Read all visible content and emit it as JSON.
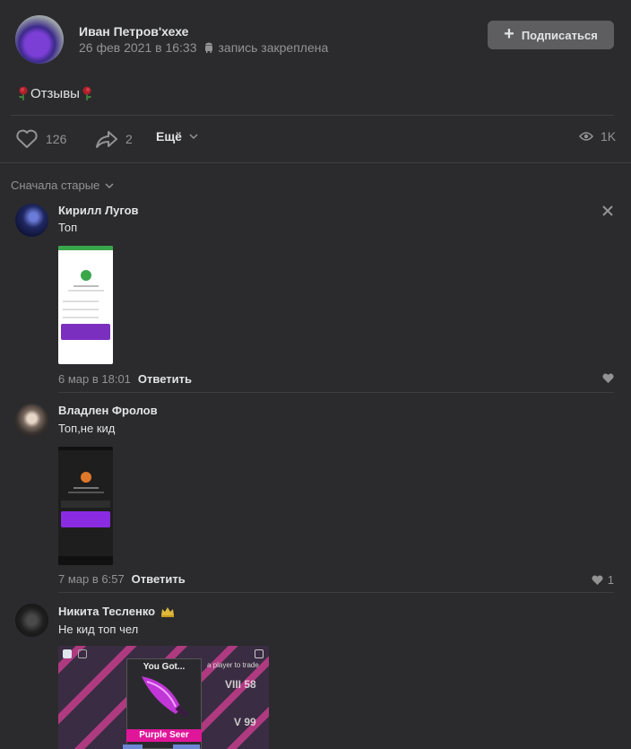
{
  "post": {
    "author": "Иван Петров'хехе",
    "date": "26 фев 2021 в 16:33",
    "pinned": "запись закреплена",
    "subscribe_label": "Подписаться",
    "text": "Отзывы",
    "likes": "126",
    "shares": "2",
    "more_label": "Ещё",
    "views": "1K"
  },
  "comments_sort": "Сначала старые",
  "comments": [
    {
      "name": "Кирилл Лугов",
      "text": "Топ",
      "date": "6 мар в 18:01",
      "reply": "Ответить",
      "likes": ""
    },
    {
      "name": "Владлен Фролов",
      "text": "Топ,не кид",
      "date": "7 мар в 6:57",
      "reply": "Ответить",
      "likes": "1"
    },
    {
      "name": "Никита Тесленко",
      "text": "Не кид топ чел",
      "image": {
        "caption": "You Got...",
        "item": "Purple Seer",
        "side_text": "a player to trade",
        "level_1": "VIII 58",
        "level_2": "V 99"
      }
    }
  ],
  "colors": {
    "bg": "#2b2b2d",
    "text": "#e1e3e6",
    "muted": "#939393",
    "button": "#5e5e60",
    "accent_purple": "#8a2be2"
  }
}
